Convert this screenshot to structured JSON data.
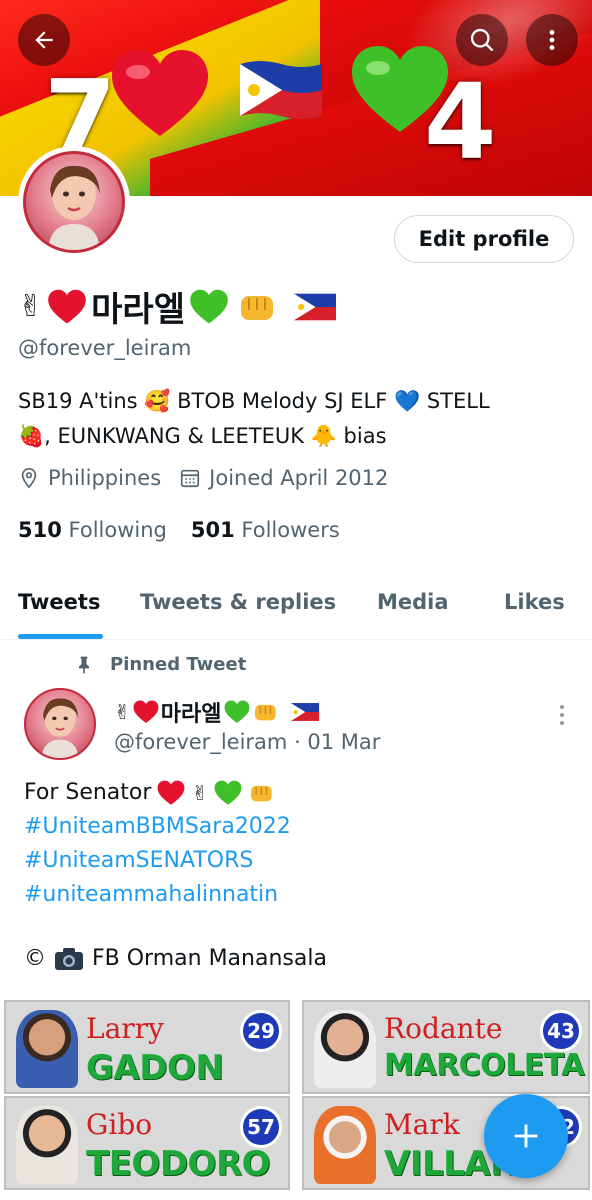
{
  "banner": {
    "left_number": "7",
    "right_number": "4"
  },
  "profile": {
    "display_name": "마라엘",
    "handle": "@forever_leiram",
    "edit_label": "Edit profile",
    "bio_line1": "SB19 A'tins 🥰 BTOB Melody SJ ELF 💙  STELL",
    "bio_line2": "🍓, EUNKWANG & LEETEUK 🐥 bias",
    "location": "Philippines",
    "joined": "Joined April 2012",
    "following_count": "510",
    "following_label": "Following",
    "followers_count": "501",
    "followers_label": "Followers"
  },
  "tabs": [
    {
      "label": "Tweets",
      "active": true
    },
    {
      "label": "Tweets & replies",
      "active": false
    },
    {
      "label": "Media",
      "active": false
    },
    {
      "label": "Likes",
      "active": false
    }
  ],
  "tweet": {
    "pinned_label": "Pinned Tweet",
    "author_name": "마라엘",
    "author_handle": "@forever_leiram",
    "date": "· 01 Mar",
    "text_line1": "For Senator",
    "hashtags": [
      "#UniteamBBMSara2022",
      "#UniteamSENATORS",
      "#uniteammahalinnatin"
    ],
    "credit": "FB Orman Manansala"
  },
  "cards": [
    {
      "first": "Larry",
      "last": "GADON",
      "number": "29"
    },
    {
      "first": "Rodante",
      "last": "MARCOLETA",
      "number": "43"
    },
    {
      "first": "Gibo",
      "last": "TEODORO",
      "number": "57"
    },
    {
      "first": "Mark",
      "last": "VILLAR",
      "number": "62"
    }
  ],
  "colors": {
    "accent": "#1d9bf0",
    "text": "#0f1419",
    "muted": "#536471"
  }
}
